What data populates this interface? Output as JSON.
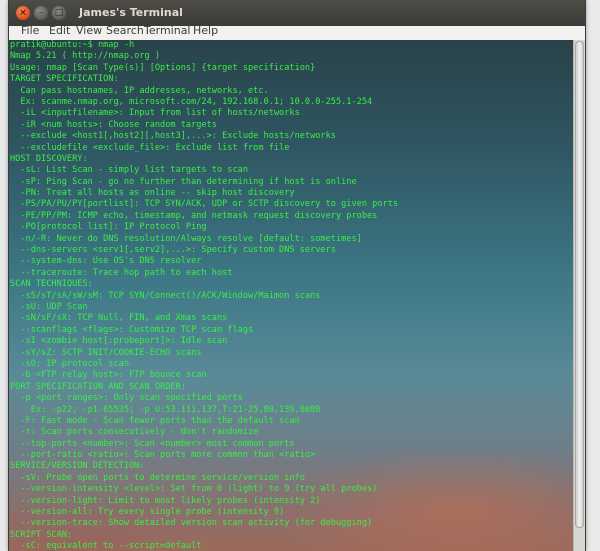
{
  "window": {
    "title": "James's Terminal"
  },
  "titlebar_icons": {
    "close": "×",
    "minimize": "–",
    "maximize": "□"
  },
  "menu": [
    "File",
    "Edit",
    "View",
    "Search",
    "Terminal",
    "Help"
  ],
  "colors": {
    "terminal_text": "#39ef45",
    "titlebar": "#3c3b37",
    "close_button": "#df4a16"
  },
  "terminal": {
    "lines": [
      "pratik@ubuntu:~$ nmap -h",
      "Nmap 5.21 ( http://nmap.org )",
      "Usage: nmap [Scan Type(s)] [Options] {target specification}",
      "TARGET SPECIFICATION:",
      "  Can pass hostnames, IP addresses, networks, etc.",
      "  Ex: scanme.nmap.org, microsoft.com/24, 192.168.0.1; 10.0.0-255.1-254",
      "  -iL <inputfilename>: Input from list of hosts/networks",
      "  -iR <num hosts>: Choose random targets",
      "  --exclude <host1[,host2][,host3],...>: Exclude hosts/networks",
      "  --excludefile <exclude_file>: Exclude list from file",
      "HOST DISCOVERY:",
      "  -sL: List Scan - simply list targets to scan",
      "  -sP: Ping Scan - go no further than determining if host is online",
      "  -PN: Treat all hosts as online -- skip host discovery",
      "  -PS/PA/PU/PY[portlist]: TCP SYN/ACK, UDP or SCTP discovery to given ports",
      "  -PE/PP/PM: ICMP echo, timestamp, and netmask request discovery probes",
      "  -PO[protocol list]: IP Protocol Ping",
      "  -n/-R: Never do DNS resolution/Always resolve [default: sometimes]",
      "  --dns-servers <serv1[,serv2],...>: Specify custom DNS servers",
      "  --system-dns: Use OS's DNS resolver",
      "  --traceroute: Trace hop path to each host",
      "SCAN TECHNIQUES:",
      "  -sS/sT/sA/sW/sM: TCP SYN/Connect()/ACK/Window/Maimon scans",
      "  -sU: UDP Scan",
      "  -sN/sF/sX: TCP Null, FIN, and Xmas scans",
      "  --scanflags <flags>: Customize TCP scan flags",
      "  -sI <zombie host[:probeport]>: Idle scan",
      "  -sY/sZ: SCTP INIT/COOKIE-ECHO scans",
      "  -sO: IP protocol scan",
      "  -b <FTP relay host>: FTP bounce scan",
      "PORT SPECIFICATION AND SCAN ORDER:",
      "  -p <port ranges>: Only scan specified ports",
      "    Ex: -p22; -p1-65535; -p U:53,111,137,T:21-25,80,139,8080",
      "  -F: Fast mode - Scan fewer ports than the default scan",
      "  -r: Scan ports consecutively - don't randomize",
      "  --top-ports <number>: Scan <number> most common ports",
      "  --port-ratio <ratio>: Scan ports more common than <ratio>",
      "SERVICE/VERSION DETECTION:",
      "  -sV: Probe open ports to determine service/version info",
      "  --version-intensity <level>: Set from 0 (light) to 9 (try all probes)",
      "  --version-light: Limit to most likely probes (intensity 2)",
      "  --version-all: Try every single probe (intensity 9)",
      "  --version-trace: Show detailed version scan activity (for debugging)",
      "SCRIPT SCAN:",
      "  -sC: equivalent to --script=default"
    ]
  },
  "scrollbar": {
    "position_fraction": 0.0,
    "visible_fraction": 0.96
  }
}
